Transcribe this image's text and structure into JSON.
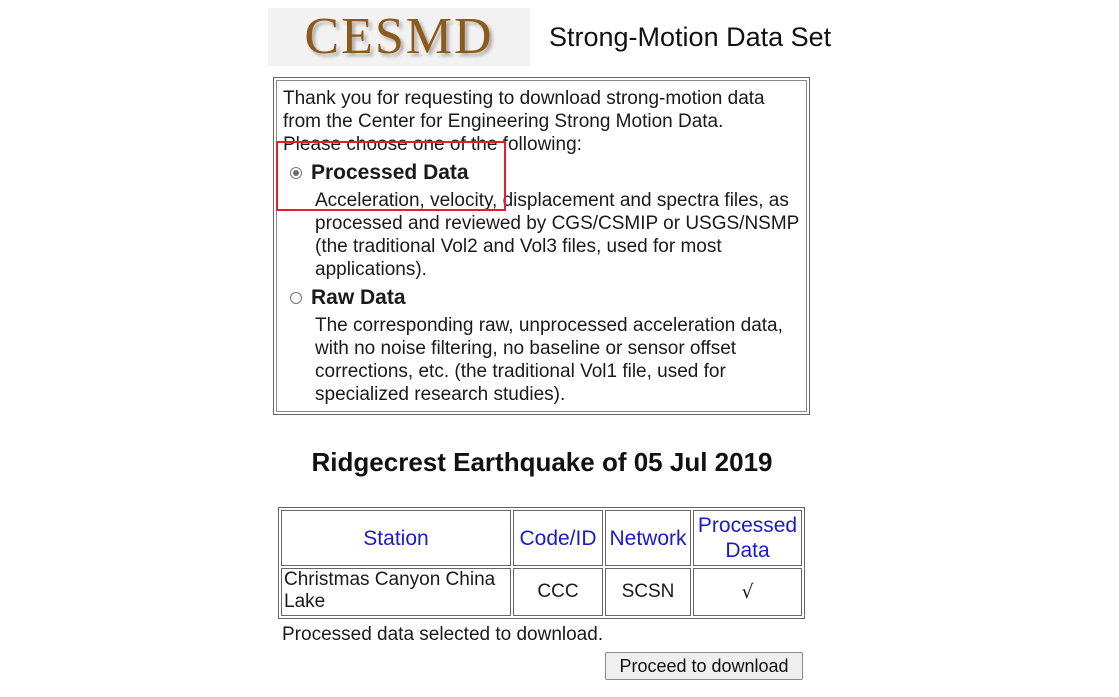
{
  "header": {
    "logo_text": "CESMD",
    "title": "Strong-Motion Data Set"
  },
  "choice_panel": {
    "intro_line_1": "Thank you for requesting to download strong-motion data",
    "intro_line_2": "from the Center for Engineering Strong Motion Data.",
    "intro_line_3": "Please choose one of the following:",
    "options": [
      {
        "label": "Processed Data",
        "checked": true,
        "description": "Acceleration, velocity, displacement and spectra files, as processed and reviewed by CGS/CSMIP or USGS/NSMP (the traditional Vol2 and Vol3 files, used for most applications)."
      },
      {
        "label": "Raw Data",
        "checked": false,
        "description": "The corresponding raw, unprocessed acceleration data, with no noise filtering, no baseline or sensor offset corrections, etc. (the traditional Vol1 file, used for specialized research studies)."
      }
    ]
  },
  "event": {
    "title": "Ridgecrest Earthquake of 05 Jul 2019"
  },
  "table": {
    "headers": {
      "station": "Station",
      "code": "Code/ID",
      "network": "Network",
      "processed": "Processed Data"
    },
    "rows": [
      {
        "station": "Christmas Canyon China Lake",
        "code": "CCC",
        "network": "SCSN",
        "processed": "√"
      }
    ]
  },
  "status": {
    "text": "Processed data selected to download."
  },
  "actions": {
    "proceed_label": "Proceed to download"
  },
  "colors": {
    "logo": "#8b5a1e",
    "header_link": "#1a1acc",
    "highlight": "#e0202a"
  }
}
